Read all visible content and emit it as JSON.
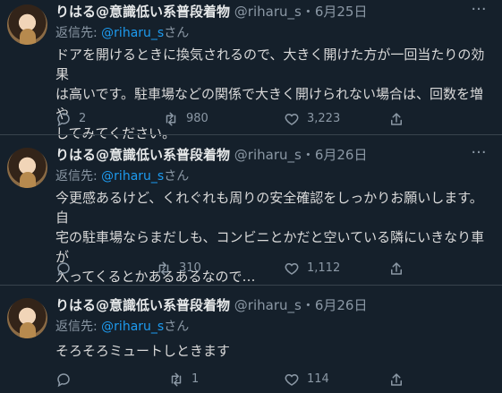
{
  "reply_prefix": "返信先: ",
  "reply_suffix": "さん",
  "tweets": [
    {
      "name": "りはる@意識低い系普段着物",
      "handle": "@riharu_s",
      "separator": "・",
      "date": "6月25日",
      "reply_to": "@riharu_s",
      "text_lines": [
        "ドアを開けるときに換気されるので、大きく開けた方が一回当たりの効果",
        "は高いです。駐車場などの関係で大きく開けられない場合は、回数を増や",
        "してみてください。"
      ],
      "replies": "2",
      "retweets": "980",
      "likes": "3,223"
    },
    {
      "name": "りはる@意識低い系普段着物",
      "handle": "@riharu_s",
      "separator": "・",
      "date": "6月26日",
      "reply_to": "@riharu_s",
      "text_lines": [
        "今更感あるけど、くれぐれも周りの安全確認をしっかりお願いします。自",
        "宅の駐車場ならまだしも、コンビニとかだと空いている隣にいきなり車が",
        "入ってくるとかあるあるなので…"
      ],
      "replies": "",
      "retweets": "310",
      "likes": "1,112"
    },
    {
      "name": "りはる@意識低い系普段着物",
      "handle": "@riharu_s",
      "separator": "・",
      "date": "6月26日",
      "reply_to": "@riharu_s",
      "text_lines": [
        "そろそろミュートしときます"
      ],
      "replies": "",
      "retweets": "1",
      "likes": "114"
    }
  ],
  "icons": {
    "more": "more-icon",
    "reply": "reply-icon",
    "retweet": "retweet-icon",
    "like": "heart-icon",
    "share": "share-icon"
  },
  "colors": {
    "background": "#15202b",
    "text": "#d9d9d9",
    "muted": "#8b98a5",
    "link": "#1d9bf0",
    "divider": "#38444d"
  }
}
